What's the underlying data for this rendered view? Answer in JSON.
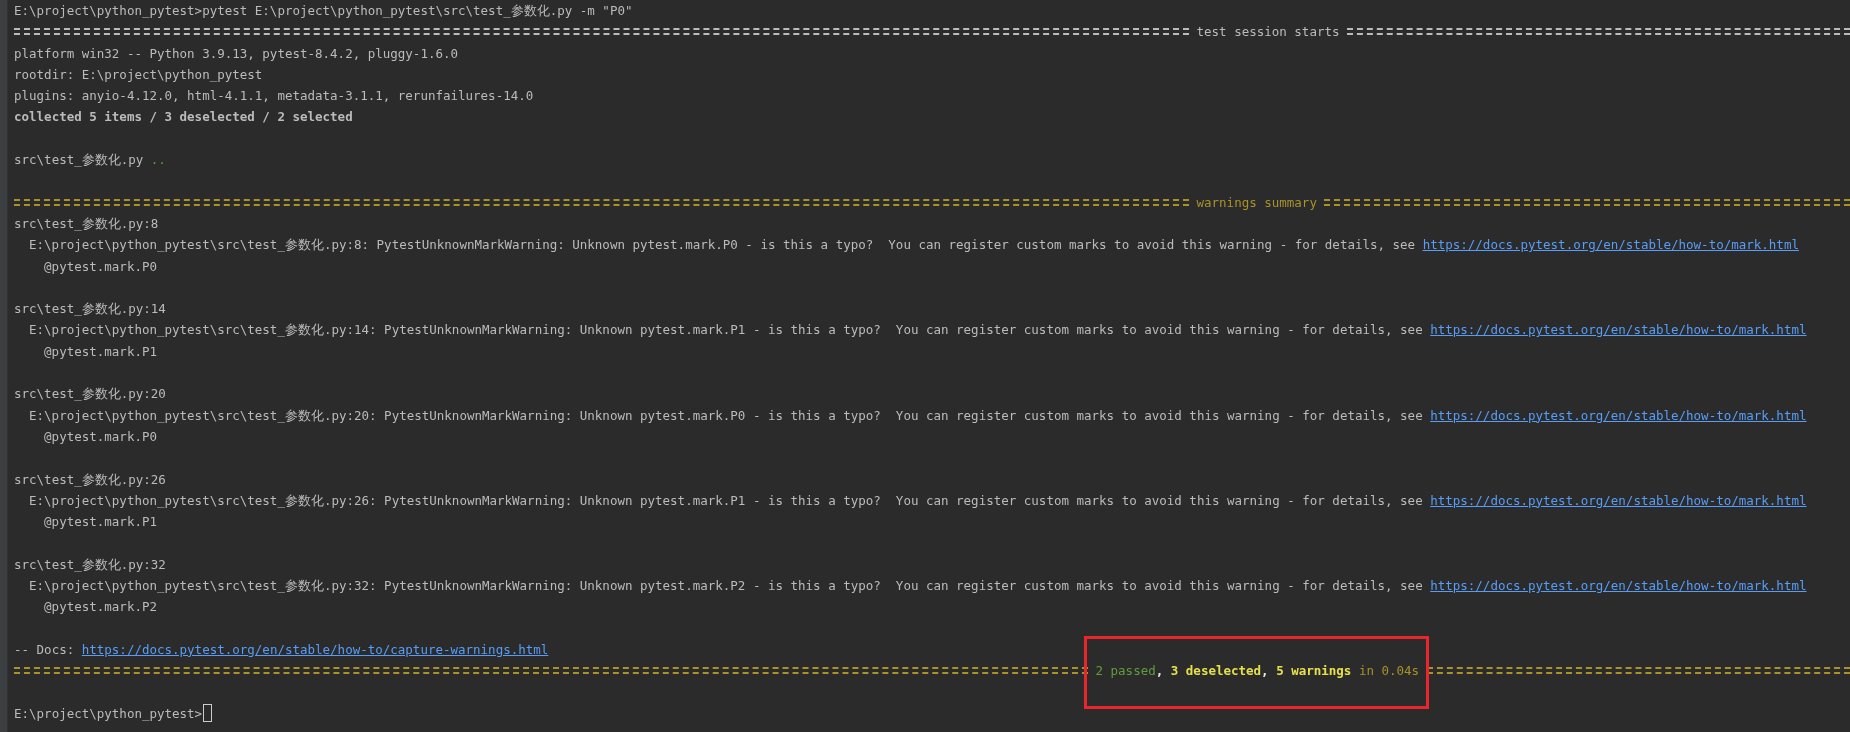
{
  "terminal": {
    "lines": [
      {
        "kind": "command",
        "text": "E:\\project\\python_pytest>pytest E:\\project\\python_pytest\\src\\test_参数化.py -m \"P0\""
      },
      {
        "kind": "separator",
        "color": "#bbbbbb",
        "title": "test session starts"
      },
      {
        "kind": "info",
        "text": "platform win32 -- Python 3.9.13, pytest-8.4.2, pluggy-1.6.0"
      },
      {
        "kind": "info",
        "text": "rootdir: E:\\project\\python_pytest"
      },
      {
        "kind": "info",
        "text": "plugins: anyio-4.12.0, html-4.1.1, metadata-3.1.1, rerunfailures-14.0"
      },
      {
        "kind": "emphasis",
        "text": "collected 5 items / 3 deselected / 2 selected"
      },
      {
        "kind": "blank"
      },
      {
        "kind": "progress",
        "text": "src\\test_参数化.py",
        "marks": ".."
      },
      {
        "kind": "blank"
      },
      {
        "kind": "separator",
        "color": "#a8922a",
        "title": "warnings summary"
      },
      {
        "kind": "location",
        "text": "src\\test_参数化.py:8"
      },
      {
        "kind": "message",
        "text": "E:\\project\\python_pytest\\src\\test_参数化.py:8: PytestUnknownMarkWarning: Unknown pytest.mark.P0 - is this a typo?  You can register custom marks to avoid this warning - for details, see",
        "link": "https://docs.pytest.org/en/stable/how-to/mark.html"
      },
      {
        "kind": "decorator",
        "text": "@pytest.mark.P0"
      },
      {
        "kind": "blank"
      },
      {
        "kind": "location",
        "text": "src\\test_参数化.py:14"
      },
      {
        "kind": "message",
        "text": "E:\\project\\python_pytest\\src\\test_参数化.py:14: PytestUnknownMarkWarning: Unknown pytest.mark.P1 - is this a typo?  You can register custom marks to avoid this warning - for details, see",
        "link": "https://docs.pytest.org/en/stable/how-to/mark.html"
      },
      {
        "kind": "decorator",
        "text": "@pytest.mark.P1"
      },
      {
        "kind": "blank"
      },
      {
        "kind": "location",
        "text": "src\\test_参数化.py:20"
      },
      {
        "kind": "message",
        "text": "E:\\project\\python_pytest\\src\\test_参数化.py:20: PytestUnknownMarkWarning: Unknown pytest.mark.P0 - is this a typo?  You can register custom marks to avoid this warning - for details, see",
        "link": "https://docs.pytest.org/en/stable/how-to/mark.html"
      },
      {
        "kind": "decorator",
        "text": "@pytest.mark.P0"
      },
      {
        "kind": "blank"
      },
      {
        "kind": "location",
        "text": "src\\test_参数化.py:26"
      },
      {
        "kind": "message",
        "text": "E:\\project\\python_pytest\\src\\test_参数化.py:26: PytestUnknownMarkWarning: Unknown pytest.mark.P1 - is this a typo?  You can register custom marks to avoid this warning - for details, see",
        "link": "https://docs.pytest.org/en/stable/how-to/mark.html"
      },
      {
        "kind": "decorator",
        "text": "@pytest.mark.P1"
      },
      {
        "kind": "blank"
      },
      {
        "kind": "location",
        "text": "src\\test_参数化.py:32"
      },
      {
        "kind": "message",
        "text": "E:\\project\\python_pytest\\src\\test_参数化.py:32: PytestUnknownMarkWarning: Unknown pytest.mark.P2 - is this a typo?  You can register custom marks to avoid this warning - for details, see",
        "link": "https://docs.pytest.org/en/stable/how-to/mark.html"
      },
      {
        "kind": "decorator",
        "text": "@pytest.mark.P2"
      },
      {
        "kind": "blank"
      },
      {
        "kind": "docs",
        "text": "-- Docs:",
        "link": "https://docs.pytest.org/en/stable/how-to/capture-warnings.html"
      },
      {
        "kind": "separator",
        "color": "#a8922a",
        "highlighted": true,
        "segments": [
          {
            "text": "2 passed",
            "color": "#5f9e3a",
            "bold": false
          },
          {
            "text": ","
          },
          {
            "text": "3 deselected",
            "color": "#e6e14a",
            "bold": true
          },
          {
            "text": ","
          },
          {
            "text": "5 warnings",
            "color": "#e6e14a",
            "bold": true
          },
          {
            "text": "in 0.04s",
            "color": "#a8922a",
            "bold": false
          }
        ]
      },
      {
        "kind": "blank"
      },
      {
        "kind": "prompt",
        "text": "E:\\project\\python_pytest>"
      }
    ]
  }
}
